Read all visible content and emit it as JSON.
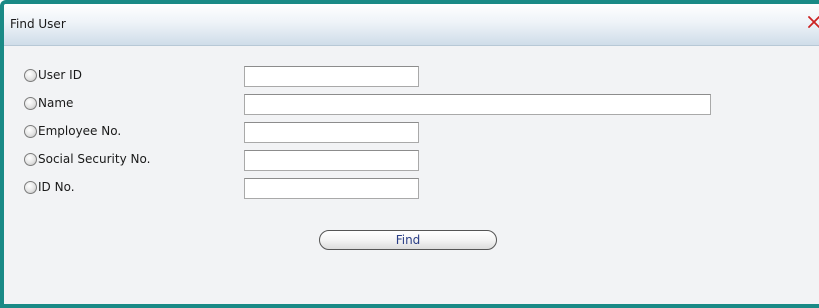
{
  "dialog": {
    "title": "Find User",
    "close_icon": "close-x-icon",
    "close_color": "#cc2222"
  },
  "fields": [
    {
      "label": "User ID",
      "value": "",
      "selected": false
    },
    {
      "label": "Name",
      "value": "",
      "selected": false
    },
    {
      "label": "Employee No.",
      "value": "",
      "selected": false
    },
    {
      "label": "Social Security No.",
      "value": "",
      "selected": false
    },
    {
      "label": "ID No.",
      "value": "",
      "selected": false
    }
  ],
  "actions": {
    "find_label": "Find"
  },
  "colors": {
    "frame_border": "#1a8a86",
    "button_text": "#2a3e86"
  }
}
